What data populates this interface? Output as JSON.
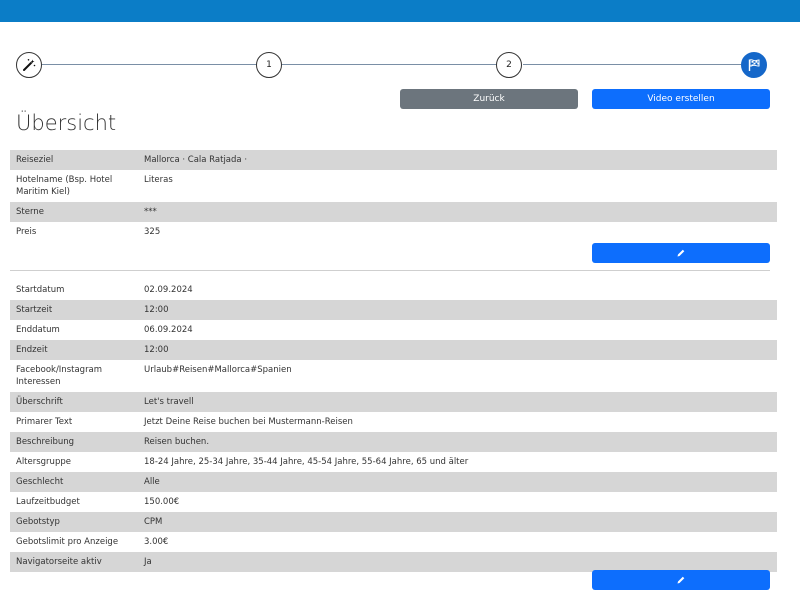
{
  "wizard": {
    "steps": [
      {
        "kind": "icon",
        "icon": "magic-wand-icon"
      },
      {
        "kind": "number",
        "label": "1"
      },
      {
        "kind": "number",
        "label": "2"
      },
      {
        "kind": "icon",
        "icon": "flag-icon"
      }
    ],
    "accent": "#1567c9"
  },
  "buttons": {
    "back": "Zurück",
    "create_video": "Video erstellen",
    "edit_icon": "pencil-icon"
  },
  "page_title": "Übersicht",
  "section1": [
    {
      "label": "Reiseziel",
      "value": "Mallorca · Cala Ratjada ·"
    },
    {
      "label": "Hotelname (Bsp. Hotel Maritim Kiel)",
      "value": "Literas"
    },
    {
      "label": "Sterne",
      "value": "***"
    },
    {
      "label": "Preis",
      "value": "325"
    }
  ],
  "section2": [
    {
      "label": "Startdatum",
      "value": "02.09.2024"
    },
    {
      "label": "Startzeit",
      "value": "12:00"
    },
    {
      "label": "Enddatum",
      "value": "06.09.2024"
    },
    {
      "label": "Endzeit",
      "value": "12:00"
    },
    {
      "label": "Facebook/Instagram Interessen",
      "value": "Urlaub#Reisen#Mallorca#Spanien"
    },
    {
      "label": "Überschrift",
      "value": "Let's travell"
    },
    {
      "label": "Primarer Text",
      "value": "Jetzt Deine Reise buchen bei Mustermann-Reisen"
    },
    {
      "label": "Beschreibung",
      "value": "Reisen buchen."
    },
    {
      "label": "Altersgruppe",
      "value": "18-24 Jahre, 25-34 Jahre, 35-44 Jahre, 45-54 Jahre, 55-64 Jahre, 65 und älter"
    },
    {
      "label": "Geschlecht",
      "value": "Alle"
    },
    {
      "label": "Laufzeitbudget",
      "value": "150.00€"
    },
    {
      "label": "Gebotstyp",
      "value": "CPM"
    },
    {
      "label": "Gebotslimit pro Anzeige",
      "value": "3.00€"
    },
    {
      "label": "Navigatorseite aktiv",
      "value": "Ja"
    }
  ],
  "colors": {
    "topbar": "#0b7dc7",
    "primary": "#0d6efd",
    "secondary": "#6c757d",
    "stripe": "#d6d6d6"
  }
}
